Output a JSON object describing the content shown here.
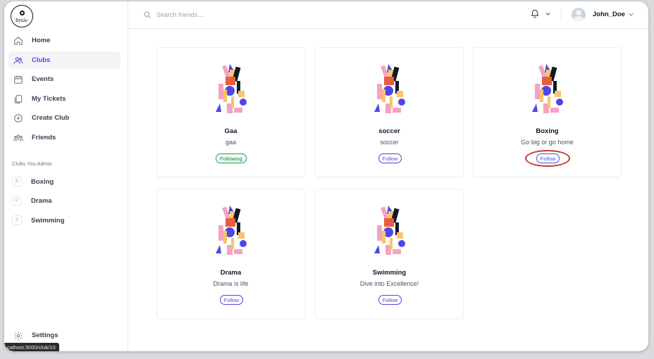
{
  "brand": {
    "logo_text": "Bynle"
  },
  "sidebar": {
    "nav": [
      {
        "label": "Home",
        "icon": "home-icon",
        "active": false
      },
      {
        "label": "Clubs",
        "icon": "users-icon",
        "active": true
      },
      {
        "label": "Events",
        "icon": "calendar-icon",
        "active": false
      },
      {
        "label": "My Tickets",
        "icon": "ticket-icon",
        "active": false
      },
      {
        "label": "Create Club",
        "icon": "plus-circle-icon",
        "active": false
      },
      {
        "label": "Friends",
        "icon": "friends-icon",
        "active": false
      }
    ],
    "section_title": "Clubs You Admin",
    "admin_clubs": [
      {
        "initial": "B",
        "label": "Boxing"
      },
      {
        "initial": "D",
        "label": "Drama"
      },
      {
        "initial": "S",
        "label": "Swimming"
      }
    ],
    "settings_label": "Settings"
  },
  "status_bar": {
    "url": "calhost:3000/club/10"
  },
  "header": {
    "search_placeholder": "Search friends....",
    "username": "John_Doe"
  },
  "clubs": [
    {
      "name": "Gaa",
      "description": "gaa",
      "button": "Following",
      "state": "following"
    },
    {
      "name": "soccer",
      "description": "soccer",
      "button": "Follow",
      "state": "follow"
    },
    {
      "name": "Boxing",
      "description": "Go big or go home",
      "button": "Follow",
      "state": "follow",
      "highlighted": true
    },
    {
      "name": "Drama",
      "description": "Drama is life",
      "button": "Follow",
      "state": "follow"
    },
    {
      "name": "Swimming",
      "description": "Dive into Excellence!",
      "button": "Follow",
      "state": "follow"
    }
  ],
  "colors": {
    "accent": "#4f46e5",
    "following_green": "#16a34a",
    "highlight_red": "#c0392b"
  }
}
